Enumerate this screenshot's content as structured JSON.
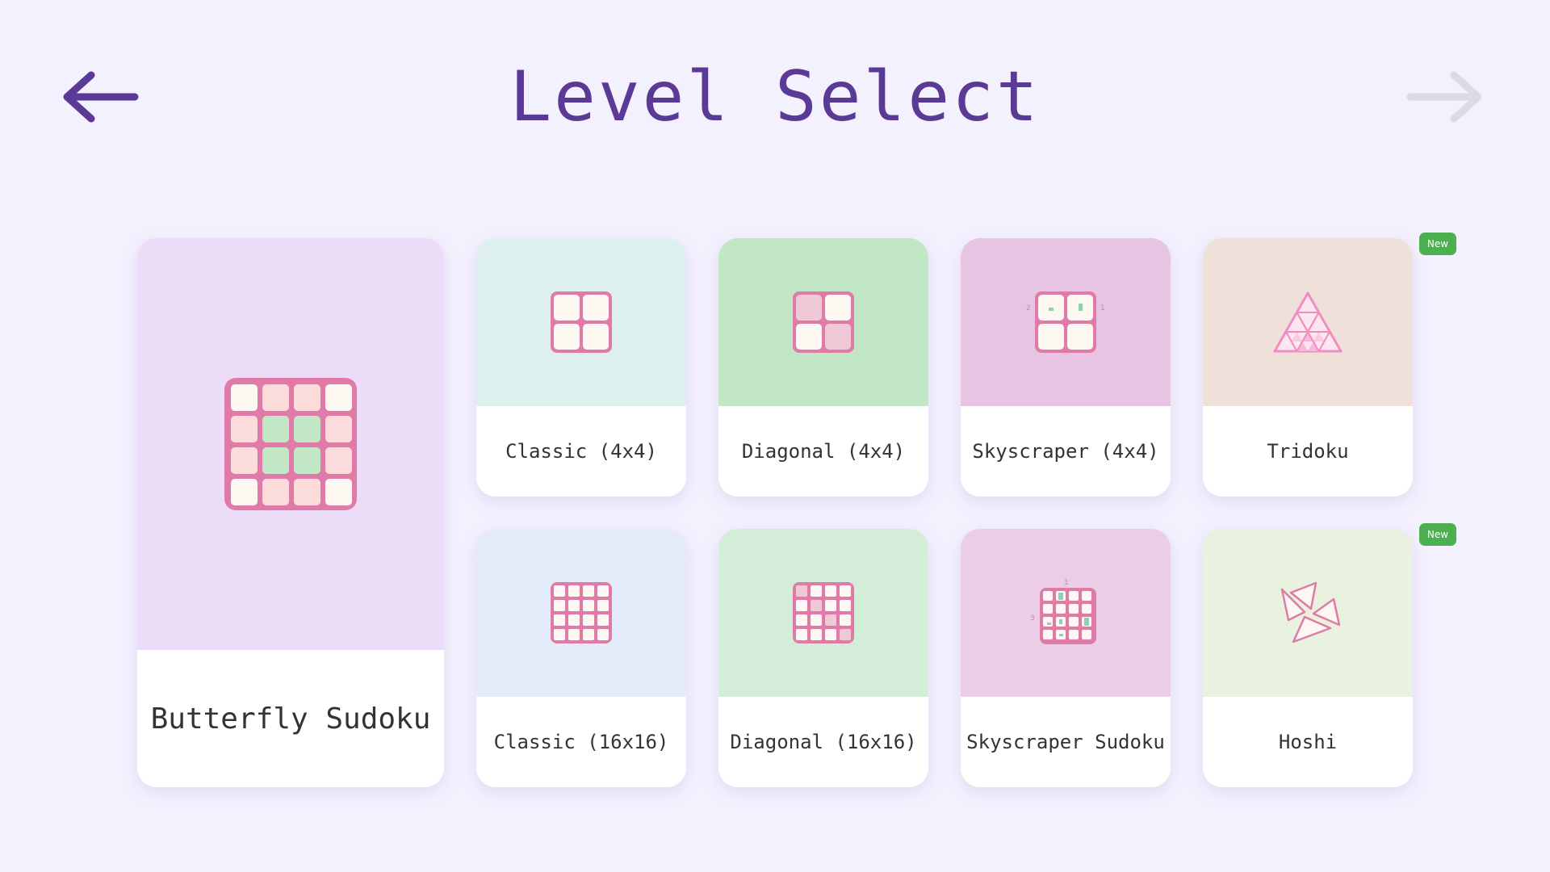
{
  "header": {
    "title": "Level Select",
    "prev_icon": "arrow-left-icon",
    "next_icon": "arrow-right-icon"
  },
  "colors": {
    "background": "#f3f1fe",
    "title": "#5b3a96",
    "arrow_active": "#5b3a96",
    "arrow_disabled": "#dcdae6",
    "grid_stroke": "#e07aa8",
    "badge": "#4caf50"
  },
  "levels": [
    {
      "label": "Butterfly Sudoku",
      "icon": "butterfly-grid-icon",
      "bg": "#ecdcf7"
    },
    {
      "label": "Classic (4x4)",
      "icon": "grid-2x2-icon",
      "bg": "#def0ee"
    },
    {
      "label": "Diagonal (4x4)",
      "icon": "diagonal-grid-icon",
      "bg": "#c1e7c7"
    },
    {
      "label": "Skyscraper (4x4)",
      "icon": "skyscraper-grid-icon",
      "bg": "#e7c4e1",
      "clues": [
        "2",
        "1"
      ]
    },
    {
      "label": "Tridoku",
      "icon": "triangle-grid-icon",
      "bg": "#f0e0da",
      "badge": "New"
    },
    {
      "label": "Classic (16x16)",
      "icon": "grid-4x4-icon",
      "bg": "#e3ecf8"
    },
    {
      "label": "Diagonal (16x16)",
      "icon": "diagonal-grid-4x4-icon",
      "bg": "#d3edd8"
    },
    {
      "label": "Skyscraper Sudoku",
      "icon": "skyscraper-sudoku-icon",
      "bg": "#ebcde5",
      "clues": [
        "1",
        "3"
      ]
    },
    {
      "label": "Hoshi",
      "icon": "star-triangles-icon",
      "bg": "#e8f2de",
      "badge": "New"
    }
  ]
}
